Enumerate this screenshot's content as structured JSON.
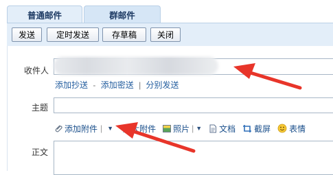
{
  "tabs": [
    {
      "label": "普通邮件"
    },
    {
      "label": "群邮件"
    }
  ],
  "toolbar": {
    "send": "发送",
    "schedule": "定时发送",
    "draft": "存草稿",
    "close": "关闭"
  },
  "recipient": {
    "label": "收件人",
    "value": ""
  },
  "recipient_links": {
    "cc": "添加抄送",
    "bcc": "添加密送",
    "separate": "分别发送",
    "dash": "-",
    "bar": "|"
  },
  "subject": {
    "label": "主题",
    "value": ""
  },
  "attach_bar": {
    "attachment": "添加附件",
    "large_attachment": "超大附件",
    "photo": "照片",
    "document": "文档",
    "screenshot": "截屏",
    "emoji": "表情"
  },
  "body": {
    "label": "正文"
  },
  "colors": {
    "annotation_arrow": "#e8352a",
    "tab_bg": "#e3eef9",
    "link": "#245e9f"
  },
  "icons": [
    "paperclip-icon",
    "dropdown-arrow-icon",
    "photo-icon",
    "document-icon",
    "screenshot-icon",
    "emoji-icon"
  ]
}
